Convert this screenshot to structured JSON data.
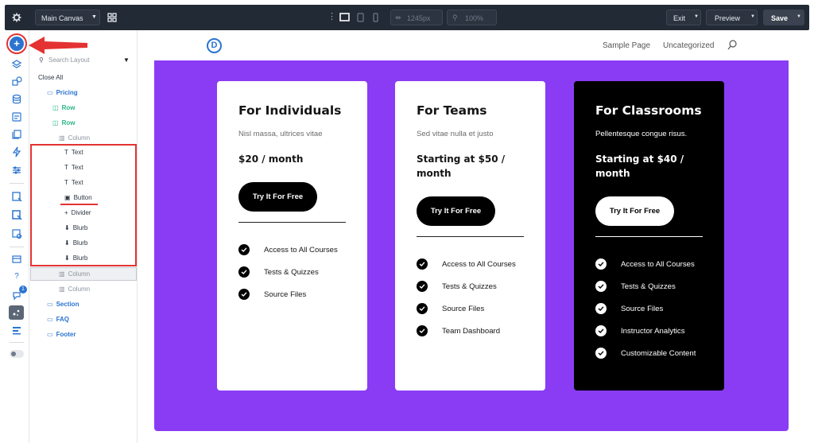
{
  "topbar": {
    "canvas_select": "Main Canvas",
    "width_value": "1245px",
    "zoom_value": "100%",
    "exit_label": "Exit",
    "preview_label": "Preview",
    "save_label": "Save"
  },
  "leftbar": {
    "notification_badge": "1"
  },
  "layers": {
    "search_placeholder": "Search Layout",
    "close_all": "Close All",
    "items": [
      {
        "label": "Pricing",
        "type": "section"
      },
      {
        "label": "Row",
        "type": "row"
      },
      {
        "label": "Row",
        "type": "row"
      },
      {
        "label": "Column",
        "type": "column"
      },
      {
        "label": "Text",
        "type": "module"
      },
      {
        "label": "Text",
        "type": "module"
      },
      {
        "label": "Text",
        "type": "module"
      },
      {
        "label": "Button",
        "type": "module"
      },
      {
        "label": "Divider",
        "type": "module"
      },
      {
        "label": "Blurb",
        "type": "module"
      },
      {
        "label": "Blurb",
        "type": "module"
      },
      {
        "label": "Blurb",
        "type": "module"
      },
      {
        "label": "Column",
        "type": "column"
      },
      {
        "label": "Column",
        "type": "column"
      },
      {
        "label": "Section",
        "type": "section"
      },
      {
        "label": "FAQ",
        "type": "section"
      },
      {
        "label": "Footer",
        "type": "section"
      }
    ]
  },
  "site": {
    "logo": "D",
    "nav": [
      "Sample Page",
      "Uncategorized"
    ]
  },
  "cards": [
    {
      "title": "For Individuals",
      "subtitle": "Nisl massa, ultrices vitae",
      "price": "$20 / month",
      "button": "Try It For Free",
      "features": [
        "Access to All Courses",
        "Tests & Quizzes",
        "Source Files"
      ]
    },
    {
      "title": "For Teams",
      "subtitle": "Sed vitae nulla et justo",
      "price": "Starting at $50 / month",
      "button": "Try It For Free",
      "features": [
        "Access to All Courses",
        "Tests & Quizzes",
        "Source Files",
        "Team Dashboard"
      ]
    },
    {
      "title": "For Classrooms",
      "subtitle": "Pellentesque congue risus.",
      "price": "Starting at $40 / month",
      "button": "Try It For Free",
      "features": [
        "Access to All Courses",
        "Tests & Quizzes",
        "Source Files",
        "Instructor Analytics",
        "Customizable Content"
      ]
    }
  ],
  "colors": {
    "accent_purple": "#8a3cf5",
    "builder_blue": "#2b74d0",
    "annotation_red": "#e43232"
  }
}
